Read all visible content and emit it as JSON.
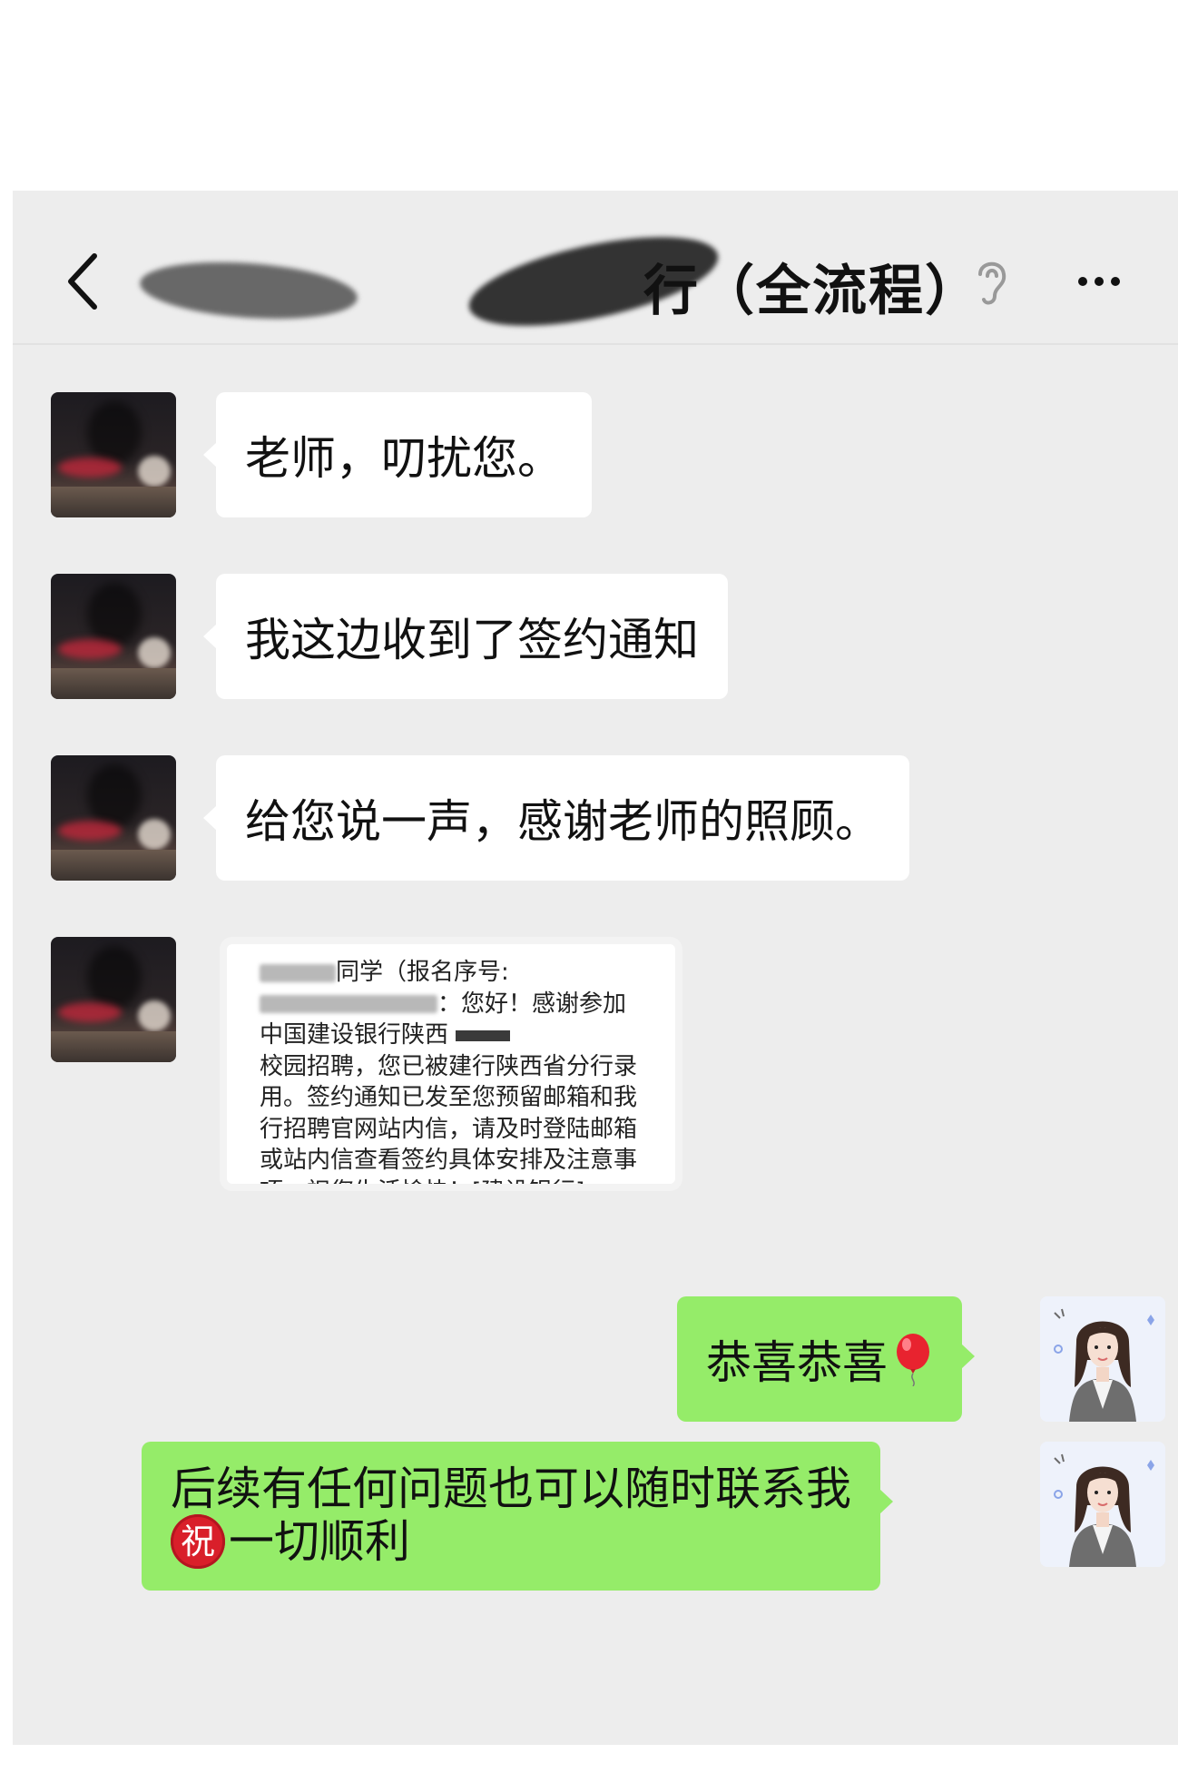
{
  "header": {
    "title": "行（全流程）"
  },
  "messages": [
    {
      "side": "left",
      "text": "老师，叨扰您。"
    },
    {
      "side": "left",
      "text": "我这边收到了签约通知"
    },
    {
      "side": "left",
      "text": "给您说一声，感谢老师的照顾。"
    },
    {
      "side": "left",
      "type": "image",
      "sms": {
        "line1": "同学（报名序号:",
        "line2": "：您好！感谢参加",
        "line3": "中国建设银行陕西",
        "line4": "校园招聘，您已被建行陕西省分行录",
        "line5": "用。签约通知已发至您预留邮箱和我",
        "line6": "行招聘官网站内信，请及时登陆邮箱",
        "line7": "或站内信查看签约具体安排及注意事",
        "line8": "项。祝您生活愉快！[建设银行]"
      }
    },
    {
      "side": "right",
      "text": "恭喜恭喜"
    },
    {
      "side": "right",
      "text_line1": "后续有任何问题也可以随时联系我",
      "badge": "祝",
      "text_line2": "一切顺利"
    }
  ],
  "icons": {
    "back": "chevron-left-icon",
    "ear": "ear-icon",
    "more": "more-dots-icon",
    "balloon": "balloon-emoji",
    "badge": "congratulation-badge"
  },
  "colors": {
    "background": "#ededed",
    "bubble_left": "#ffffff",
    "bubble_right": "#95ec69",
    "badge_red": "#d91f2a"
  }
}
